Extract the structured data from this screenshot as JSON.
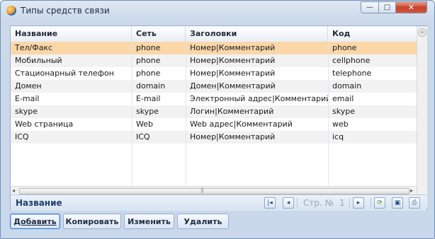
{
  "window": {
    "title": "Типы средств связи",
    "controls": {
      "minimize": "—",
      "maximize": "□",
      "close": "✕"
    }
  },
  "table": {
    "columns": [
      "Название",
      "Сеть",
      "Заголовки",
      "Код"
    ],
    "rows": [
      [
        "Тел/Факс",
        "phone",
        "Номер|Комментарий",
        "phone"
      ],
      [
        "Мобильный",
        "phone",
        "Номер|Комментарий",
        "cellphone"
      ],
      [
        "Стационарный телефон",
        "phone",
        "Номер|Комментарий",
        "telephone"
      ],
      [
        "Домен",
        "domain",
        "Домен|Комментарий",
        "domain"
      ],
      [
        "E-mail",
        "E-mail",
        "Электронный адрес|Комментарий",
        "email"
      ],
      [
        "skype",
        "skype",
        "Логин|Комментарий",
        "skype"
      ],
      [
        "Web страница",
        "Web",
        "Web адрес|Комментарий",
        "web"
      ],
      [
        "ICQ",
        "ICQ",
        "Номер|Комментарий",
        "icq"
      ]
    ],
    "selected_row": 0
  },
  "footer": {
    "title": "Название",
    "page_label": "Стр. №",
    "page_number": "1"
  },
  "buttons": {
    "add": "Добавить",
    "copy": "Копировать",
    "edit": "Изменить",
    "delete": "Удалить"
  },
  "colors": {
    "selection": "#fbd7a8",
    "frame": "#c9d8ea",
    "accent": "#1f3f6b"
  }
}
